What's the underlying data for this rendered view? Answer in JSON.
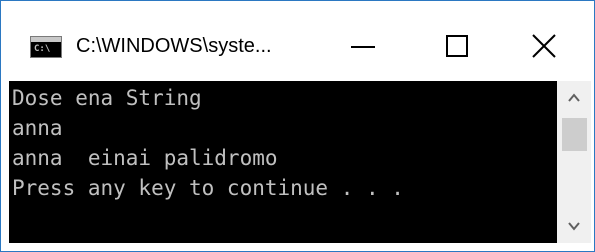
{
  "window": {
    "title": "C:\\WINDOWS\\syste...",
    "app_icon_text": "C:\\"
  },
  "console": {
    "lines": [
      "Dose ena String",
      "anna",
      "anna  einai palidromo",
      "Press any key to continue . . ."
    ]
  },
  "icons": {
    "minimize": "minimize-icon",
    "maximize": "maximize-icon",
    "close": "close-icon",
    "scroll_up": "chevron-up-icon",
    "scroll_down": "chevron-down-icon"
  },
  "colors": {
    "console_background": "#000000",
    "console_text": "#c0c0c0",
    "window_border": "#2b78c2",
    "scrollbar_track": "#f0f0f0",
    "scrollbar_thumb": "#cdcdcd"
  }
}
